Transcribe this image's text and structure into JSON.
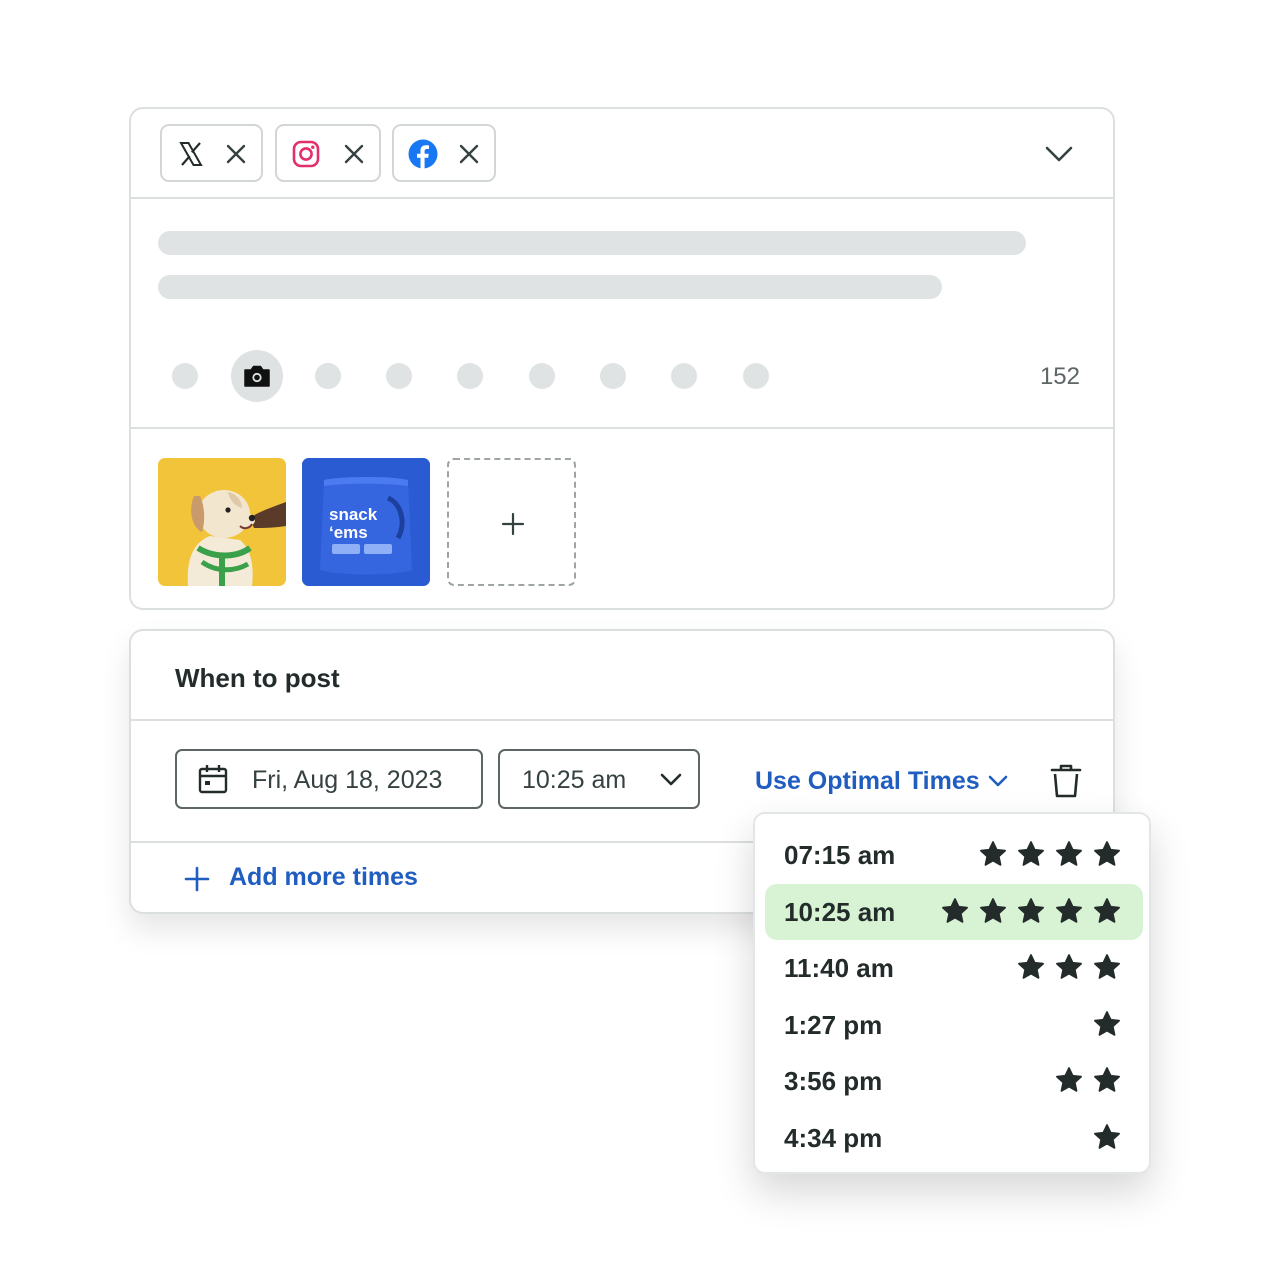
{
  "networks": [
    {
      "name": "X",
      "icon": "x-logo-icon",
      "remove_icon": "close-icon"
    },
    {
      "name": "Instagram",
      "icon": "instagram-logo-icon",
      "color": "#e1306c",
      "remove_icon": "close-icon"
    },
    {
      "name": "Facebook",
      "icon": "facebook-logo-icon",
      "color": "#1877f2",
      "remove_icon": "close-icon"
    }
  ],
  "editor": {
    "character_count": "152",
    "active_tool_icon": "camera-icon"
  },
  "media": {
    "items": [
      {
        "name": "dog-photo",
        "bg": "#f2c439"
      },
      {
        "name": "snack-ems-product",
        "bg": "#2a5bd2",
        "label_line1": "snack",
        "label_line2": "‘ems"
      }
    ],
    "add_icon": "plus-icon"
  },
  "schedule": {
    "title": "When to post",
    "date": "Fri, Aug 18, 2023",
    "time": "10:25 am",
    "optimal_label": "Use Optimal Times",
    "add_more_label": "Add more times",
    "accent": "#1f5dc0"
  },
  "optimal_times": {
    "selected_bg": "#d7f3d4",
    "options": [
      {
        "time": "07:15 am",
        "stars": 4,
        "selected": false
      },
      {
        "time": "10:25 am",
        "stars": 5,
        "selected": true
      },
      {
        "time": "11:40 am",
        "stars": 3,
        "selected": false
      },
      {
        "time": "1:27 pm",
        "stars": 1,
        "selected": false
      },
      {
        "time": "3:56 pm",
        "stars": 2,
        "selected": false
      },
      {
        "time": "4:34 pm",
        "stars": 1,
        "selected": false
      }
    ]
  }
}
